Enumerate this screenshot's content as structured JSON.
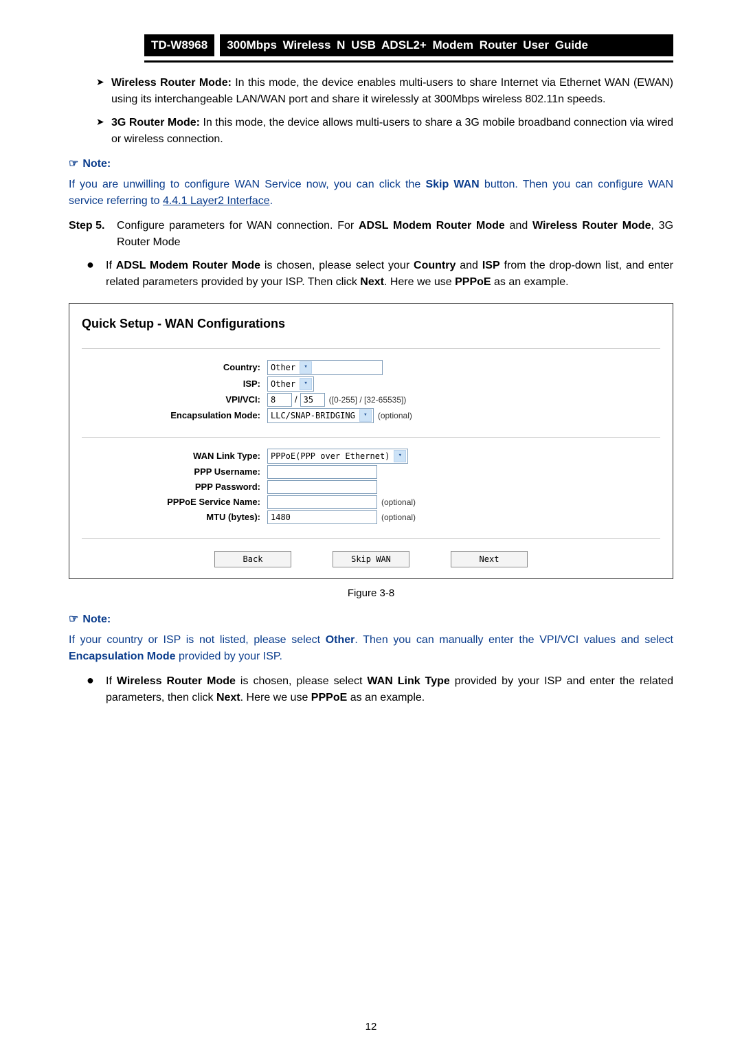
{
  "header": {
    "model": "TD-W8968",
    "title": "300Mbps Wireless N USB ADSL2+ Modem Router User Guide"
  },
  "bullet_wireless": {
    "label": "Wireless Router Mode:",
    "text": " In this mode, the device enables multi-users to share Internet via Ethernet WAN (EWAN) using its interchangeable LAN/WAN port and share it wirelessly at 300Mbps wireless 802.11n speeds."
  },
  "bullet_3g": {
    "label": "3G Router Mode:",
    "text": " In this mode, the device allows multi-users to share a 3G mobile broadband connection via wired or wireless connection."
  },
  "note1": {
    "label": "Note:",
    "pre": "If you are unwilling to configure WAN Service now, you can click the ",
    "skipwan": "Skip WAN",
    "mid": " button. Then you can configure WAN service referring to ",
    "link": "4.4.1 Layer2 Interface",
    "post": "."
  },
  "step5": {
    "label": "Step 5.",
    "pre": "Configure parameters for WAN connection. For ",
    "b1": "ADSL Modem Router Mode",
    "mid1": " and ",
    "b2": "Wireless Router Mode",
    "post": ", 3G Router Mode"
  },
  "dot_adsl": {
    "pre": "If ",
    "b1": "ADSL Modem Router Mode",
    "mid1": " is chosen, please select your ",
    "b2": "Country",
    "mid2": " and ",
    "b3": "ISP",
    "mid3": " from the drop-down list, and enter related parameters provided by your ISP. Then click ",
    "b4": "Next",
    "mid4": ". Here we use ",
    "b5": "PPPoE",
    "post": " as an example."
  },
  "figure": {
    "title": "Quick Setup - WAN Configurations",
    "labels": {
      "country": "Country:",
      "isp": "ISP:",
      "vpivci": "VPI/VCI:",
      "encap": "Encapsulation Mode:",
      "wanlink": "WAN Link Type:",
      "pppuser": "PPP Username:",
      "ppppass": "PPP Password:",
      "pppoesvc": "PPPoE Service Name:",
      "mtu": "MTU (bytes):"
    },
    "values": {
      "country": "Other",
      "isp": "Other",
      "vpi": "8",
      "vci": "35",
      "vpivci_hint": "([0-255] / [32-65535])",
      "encap": "LLC/SNAP-BRIDGING",
      "encap_hint": "(optional)",
      "wanlink": "PPPoE(PPP over Ethernet)",
      "pppuser": "",
      "ppppass": "",
      "pppoesvc": "",
      "pppoesvc_hint": "(optional)",
      "mtu": "1480",
      "mtu_hint": "(optional)"
    },
    "buttons": {
      "back": "Back",
      "skip": "Skip WAN",
      "next": "Next"
    },
    "caption": "Figure 3-8"
  },
  "note2": {
    "label": "Note:",
    "pre": "If your country or ISP is not listed, please select ",
    "b1": "Other",
    "mid": ". Then you can manually enter the VPI/VCI values and select ",
    "b2": "Encapsulation Mode",
    "post": " provided by your ISP."
  },
  "dot_wireless": {
    "pre": "If ",
    "b1": "Wireless Router Mode",
    "mid1": " is chosen, please select ",
    "b2": "WAN Link Type",
    "mid2": " provided by your ISP and enter the related parameters, then click ",
    "b3": "Next",
    "mid3": ". Here we use ",
    "b4": "PPPoE",
    "post": " as an example."
  },
  "page_number": "12"
}
